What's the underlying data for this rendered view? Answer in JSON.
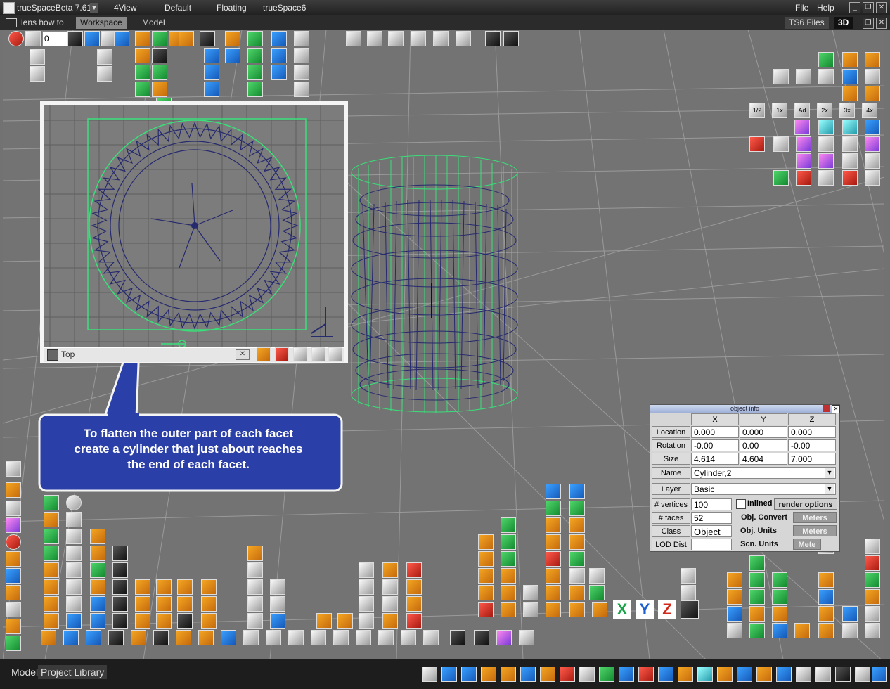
{
  "window": {
    "app_title": "trueSpaceBeta 7.61",
    "layouts": [
      "4View",
      "Default",
      "Floating",
      "trueSpace6"
    ],
    "menu": {
      "file": "File",
      "help": "Help"
    }
  },
  "tabbar": {
    "lens_label": "lens how to",
    "tabs": [
      "Workspace",
      "Model"
    ],
    "files_label": "TS6 Files",
    "mode_3d": "3D"
  },
  "anim": {
    "frame_value": "0"
  },
  "topview": {
    "title": "Top"
  },
  "callout": {
    "lines": [
      "To flatten the outer part of each facet",
      "create a cylinder that just about reaches",
      "the end of each facet."
    ]
  },
  "object_info": {
    "title": "object info",
    "columns": [
      "X",
      "Y",
      "Z"
    ],
    "location": {
      "label": "Location",
      "x": "0.000",
      "y": "0.000",
      "z": "0.000"
    },
    "rotation": {
      "label": "Rotation",
      "x": "-0.00",
      "y": "0.00",
      "z": "-0.00"
    },
    "size": {
      "label": "Size",
      "x": "4.614",
      "y": "4.604",
      "z": "7.000"
    },
    "name": {
      "label": "Name",
      "value": "Cylinder,2"
    },
    "layer": {
      "label": "Layer",
      "value": "Basic"
    },
    "vertices": {
      "label": "# vertices",
      "value": "100"
    },
    "faces": {
      "label": "# faces",
      "value": "52"
    },
    "class": {
      "label": "Class",
      "value": "Object"
    },
    "lod": {
      "label": "LOD Dist",
      "value": ""
    },
    "inlined_label": "Inlined",
    "render_options": "render options",
    "obj_convert": "Obj. Convert",
    "obj_units": "Obj. Units",
    "scn_units": "Scn. Units",
    "meters": "Meters",
    "meters_partial": "Mete"
  },
  "axis_buttons": [
    "X",
    "Y",
    "Z"
  ],
  "zoom_buttons": [
    "1/2",
    "1x",
    "Ad",
    "2x",
    "3x",
    "4x"
  ],
  "bottom_tabs": [
    "Model",
    "Project Library"
  ],
  "colors": {
    "viewport_bg": "#737373",
    "grid": "#9a9a9a",
    "wire_blue": "#262a6e",
    "wire_green": "#39e07a",
    "callout_fill": "#2b3fa8"
  }
}
